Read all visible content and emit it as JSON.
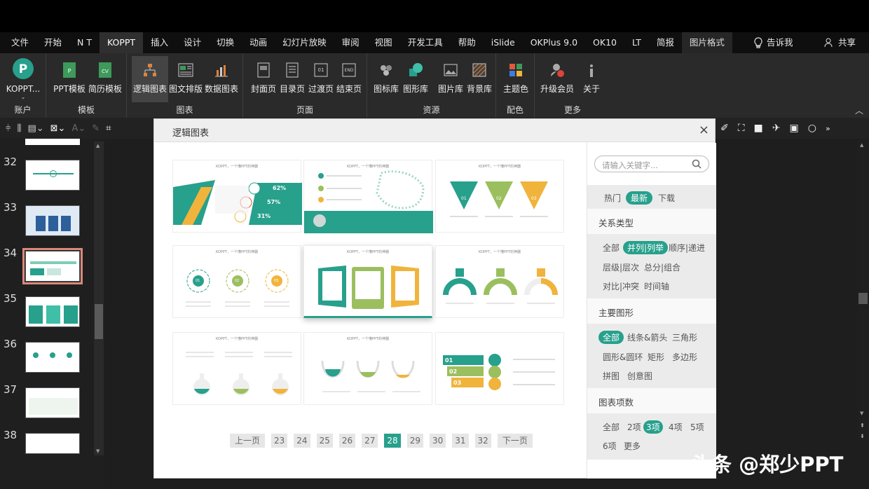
{
  "menu": {
    "items": [
      "文件",
      "开始",
      "N T",
      "KOPPT",
      "插入",
      "设计",
      "切换",
      "动画",
      "幻灯片放映",
      "审阅",
      "视图",
      "开发工具",
      "帮助",
      "iSlide",
      "OKPlus 9.0",
      "OK10",
      "LT",
      "简报",
      "图片格式"
    ],
    "tell": "告诉我",
    "share": "共享"
  },
  "ribbon": {
    "account": {
      "btn": "KOPPT...",
      "label": "账户"
    },
    "template": {
      "btns": [
        "PPT模板",
        "简历模板"
      ],
      "label": "模板"
    },
    "chart": {
      "btns": [
        "逻辑图表",
        "图文排版",
        "数据图表"
      ],
      "label": "图表"
    },
    "page": {
      "btns": [
        "封面页",
        "目录页",
        "过渡页",
        "结束页"
      ],
      "label": "页面"
    },
    "resource": {
      "btns": [
        "图标库",
        "图形库",
        "图片库",
        "背景库"
      ],
      "label": "资源"
    },
    "color": {
      "btns": [
        "主题色"
      ],
      "label": "配色"
    },
    "more": {
      "btns": [
        "升级会员",
        "关于"
      ],
      "label": "更多"
    }
  },
  "slides": [
    "32",
    "33",
    "34",
    "35",
    "36",
    "37",
    "38"
  ],
  "dialog": {
    "title": "逻辑图表",
    "close": "×",
    "card_title": "KOPPT，一个懂PPT的神器",
    "cards": [
      {
        "values": [
          "62%",
          "57%",
          "31%"
        ]
      },
      {
        "values": []
      },
      {
        "values": [
          "01",
          "02",
          "03"
        ]
      },
      {
        "values": [
          "01",
          "02",
          "03"
        ]
      },
      {
        "values": []
      },
      {
        "values": []
      },
      {
        "values": []
      },
      {
        "values": []
      },
      {
        "values": [
          "01",
          "02",
          "03"
        ]
      }
    ],
    "pager": {
      "prev": "上一页",
      "next": "下一页",
      "pages": [
        "23",
        "24",
        "25",
        "26",
        "27",
        "28",
        "29",
        "30",
        "31",
        "32"
      ],
      "current": "28"
    },
    "search_placeholder": "请输入关键字...",
    "sort": [
      "热门",
      "最新",
      "下载"
    ],
    "sections": [
      {
        "title": "关系类型",
        "tags": [
          "全部",
          "并列|列举",
          "顺序|递进",
          "层级|层次",
          "总分|组合",
          "对比|冲突",
          "时间轴"
        ],
        "selected": "并列|列举"
      },
      {
        "title": "主要图形",
        "tags": [
          "全部",
          "线条&箭头",
          "三角形",
          "圆形&圆环",
          "矩形",
          "多边形",
          "拼图",
          "创意图"
        ],
        "selected": "全部"
      },
      {
        "title": "图表项数",
        "tags": [
          "全部",
          "2项",
          "3项",
          "4项",
          "5项",
          "6项",
          "更多"
        ],
        "selected": "3项"
      }
    ]
  },
  "watermark": "头条 @郑少PPT",
  "colors": {
    "accent": "#27a08c",
    "green2": "#9bbf5e",
    "yellow": "#f0b43c"
  }
}
